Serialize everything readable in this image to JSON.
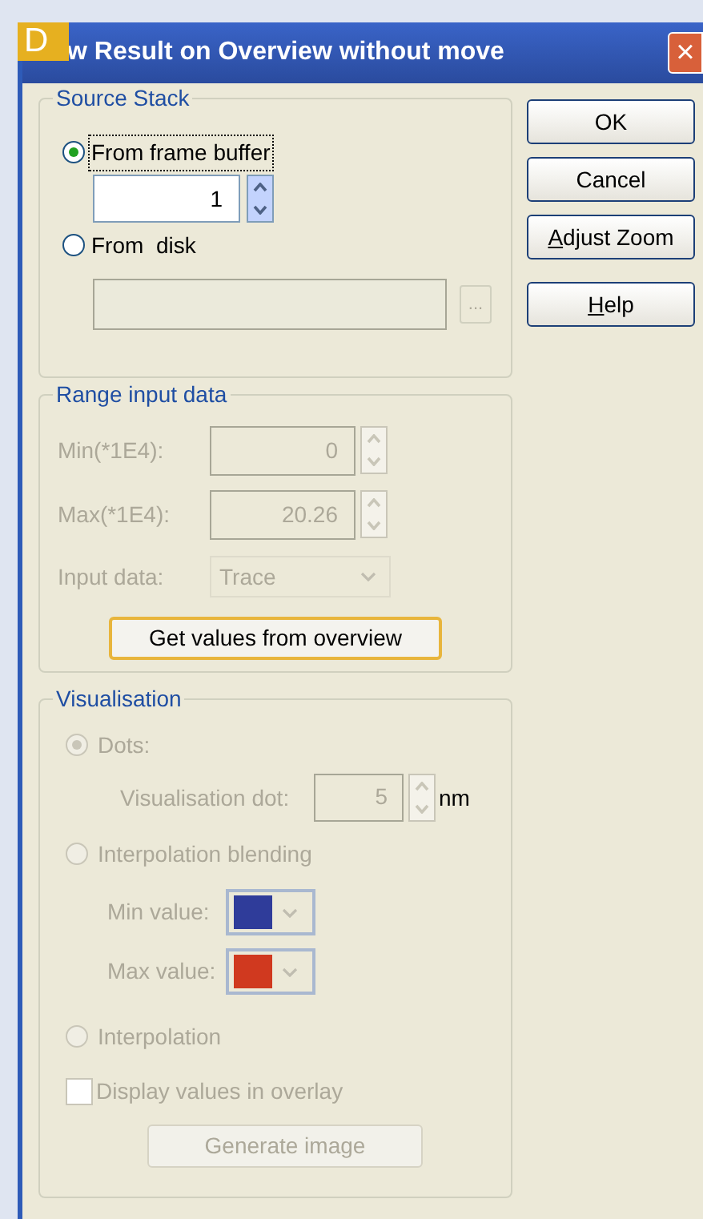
{
  "figure_badge": "D",
  "window": {
    "title": "w Result on Overview without move",
    "close": "×"
  },
  "source_stack": {
    "title": "Source Stack",
    "frame_value": "1",
    "browse": "...",
    "options": [
      {
        "label": "From frame buffer",
        "selected": true,
        "focused": true
      },
      {
        "label": "From  disk",
        "selected": false,
        "focused": false
      }
    ]
  },
  "range": {
    "title": "Range input data",
    "disabled": true,
    "action": "Get values from overview",
    "fields": [
      {
        "kind": "spin",
        "label": "Min(*1E4):",
        "value": "0"
      },
      {
        "kind": "spin",
        "label": "Max(*1E4):",
        "value": "20.26"
      },
      {
        "kind": "dropdown",
        "label": "Input data:",
        "value": "Trace"
      }
    ]
  },
  "visualisation": {
    "title": "Visualisation",
    "disabled": true,
    "items": [
      {
        "kind": "radio",
        "label": "Dots:",
        "selected": true
      },
      {
        "kind": "spin",
        "label": "Visualisation dot:",
        "value": "5",
        "unit": "nm"
      },
      {
        "kind": "radio",
        "label": "Interpolation blending",
        "selected": false
      },
      {
        "kind": "color",
        "label": "Min value:",
        "color": "#2f3c9a"
      },
      {
        "kind": "color",
        "label": "Max value:",
        "color": "#d0391f"
      },
      {
        "kind": "radio",
        "label": "Interpolation",
        "selected": false
      },
      {
        "kind": "checkbox",
        "label": "Display values in overlay",
        "checked": false
      },
      {
        "kind": "button",
        "label": "Generate image"
      }
    ]
  },
  "buttons": [
    {
      "label": "OK",
      "underline_first": false
    },
    {
      "label": "Cancel",
      "underline_first": false
    },
    {
      "label": "Adjust Zoom",
      "underline_first": true
    },
    {
      "label": "Help",
      "underline_first": true
    }
  ]
}
